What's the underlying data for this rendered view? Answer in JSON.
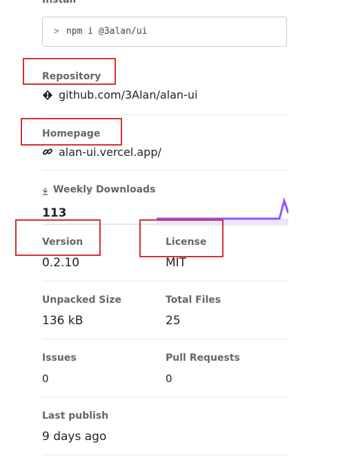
{
  "install": {
    "label": "Install",
    "prompt": ">",
    "command": "npm i @3alan/ui"
  },
  "repository": {
    "label": "Repository",
    "icon": "git-icon",
    "value": "github.com/3Alan/alan-ui"
  },
  "homepage": {
    "label": "Homepage",
    "icon": "link-icon",
    "value": "alan-ui.vercel.app/"
  },
  "weekly_downloads": {
    "label": "Weekly Downloads",
    "icon": "download-icon",
    "value": "113",
    "sparkline_color": "#8956ff"
  },
  "version": {
    "label": "Version",
    "value": "0.2.10"
  },
  "license": {
    "label": "License",
    "value": "MIT"
  },
  "unpacked_size": {
    "label": "Unpacked Size",
    "value": "136 kB"
  },
  "total_files": {
    "label": "Total Files",
    "value": "25"
  },
  "issues": {
    "label": "Issues",
    "value": "0"
  },
  "pull_requests": {
    "label": "Pull Requests",
    "value": "0"
  },
  "last_publish": {
    "label": "Last publish",
    "value": "9 days ago"
  },
  "colors": {
    "annotation_red": "#d32f2f",
    "accent": "#8956ff"
  }
}
